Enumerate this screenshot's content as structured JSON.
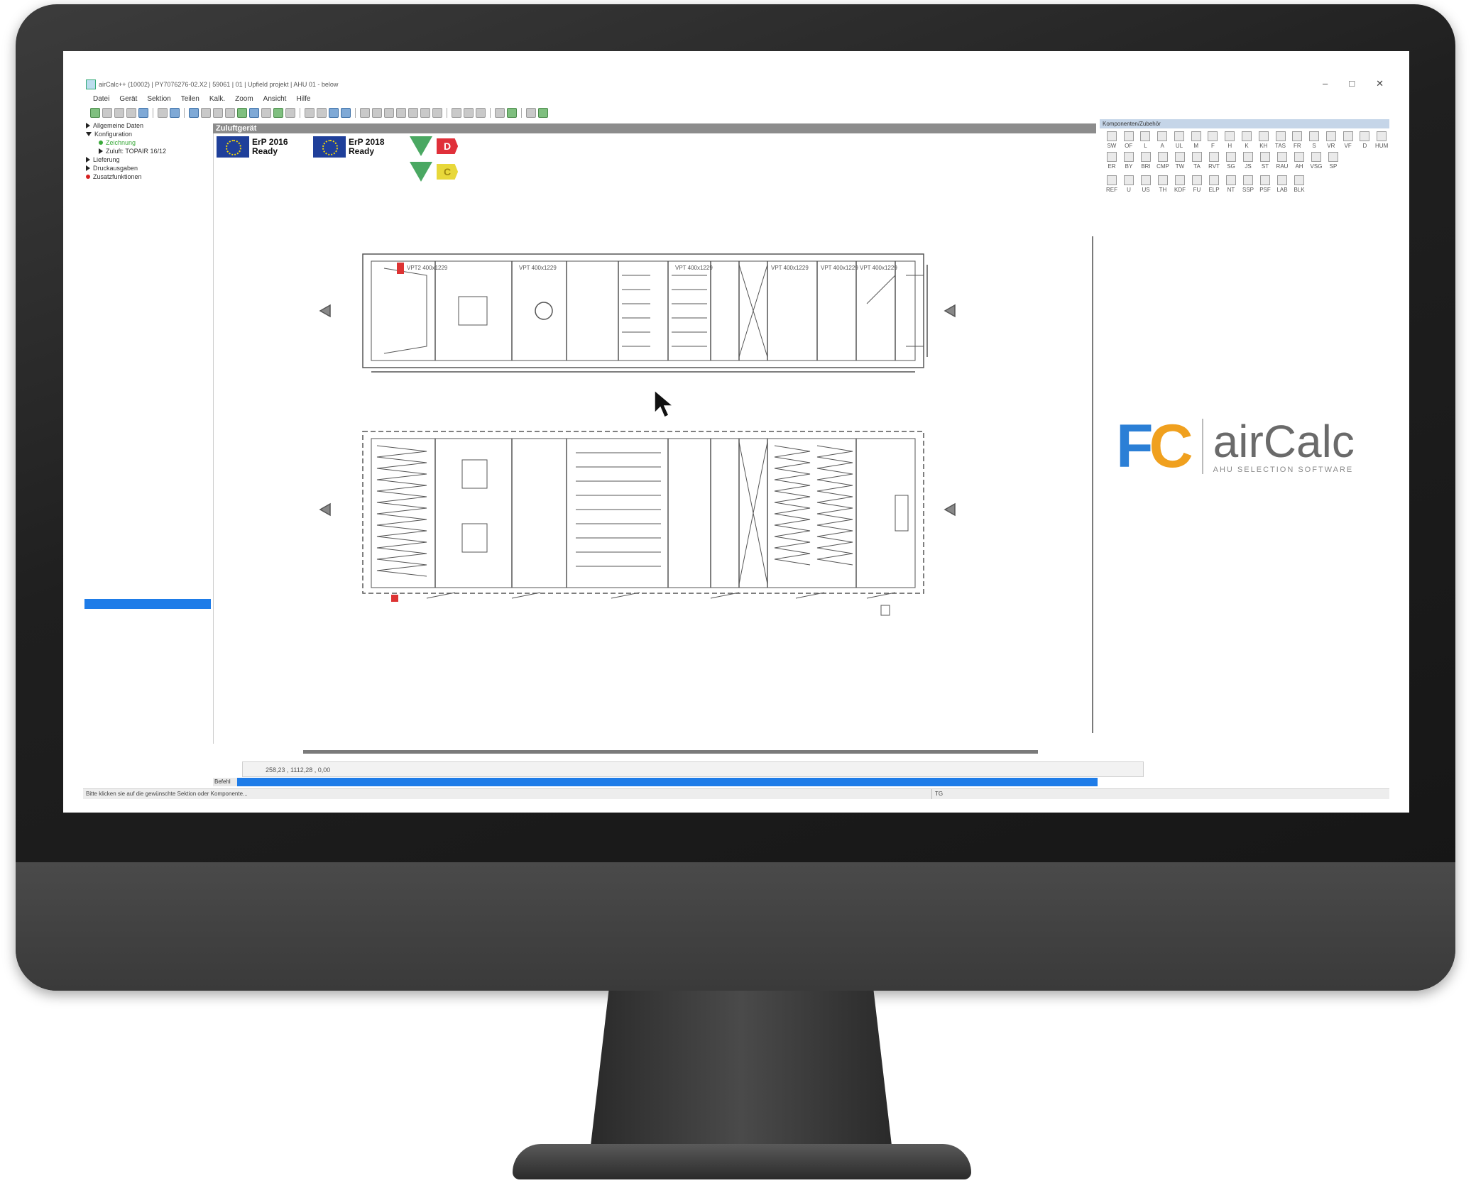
{
  "window": {
    "title": "airCalc++ (10002) | PY7076276-02.X2 | 59061 | 01 | Upfield projekt | AHU 01 - below",
    "controls": [
      "–",
      "□",
      "✕"
    ]
  },
  "menu": {
    "items": [
      "Datei",
      "Gerät",
      "Sektion",
      "Teilen",
      "Kalk.",
      "Zoom",
      "Ansicht",
      "Hilfe"
    ]
  },
  "tree": {
    "items": [
      {
        "label": "Allgemeine Daten"
      },
      {
        "label": "Konfiguration"
      },
      {
        "label": "Zeichnung"
      },
      {
        "label": "Zuluft: TOPAIR 16/12"
      },
      {
        "label": "Lieferung"
      },
      {
        "label": "Druckausgaben"
      },
      {
        "label": "Zusatzfunktionen"
      }
    ]
  },
  "drawing": {
    "header": "Zuluftgerät",
    "erp": [
      {
        "year": "ErP 2016",
        "status": "Ready"
      },
      {
        "year": "ErP 2018",
        "status": "Ready"
      }
    ],
    "energy_classes": [
      {
        "grade": "D",
        "color": "#e0303a"
      },
      {
        "grade": "C",
        "color": "#e8d83a"
      }
    ],
    "fan_labels": [
      "VPT2 400x1229",
      "VPT 400x1229",
      "VPT 400x1229",
      "VPT 400x1229",
      "VPT 400x1229",
      "VPT 400x1229"
    ]
  },
  "coordinates": "258,23 , 1112,28 , 0,00",
  "command_label": "Befehl",
  "status": {
    "hint": "Bitte klicken sie auf die gewünschte Sektion oder Komponente...",
    "field": "TG"
  },
  "right_panel": {
    "header": "Komponenten/Zubehör",
    "row1": [
      "SW",
      "OF",
      "L",
      "A",
      "UL",
      "M",
      "F",
      "H",
      "K",
      "KH",
      "TAS",
      "FR",
      "S",
      "VR",
      "VF",
      "D",
      "HUM"
    ],
    "row2": [
      "ER",
      "BY",
      "BRI",
      "CMP",
      "TW",
      "TA",
      "RVT",
      "SG",
      "JS",
      "ST",
      "RAU",
      "AH",
      "VSG",
      "SP"
    ],
    "row3": [
      "REF",
      "U",
      "US",
      "TH",
      "KDF",
      "FU",
      "ELP",
      "NT",
      "SSP",
      "PSF",
      "LAB",
      "BLK"
    ]
  },
  "logo": {
    "letters_f": "F",
    "letters_c": "C",
    "name": "airCalc",
    "tagline": "AHU SELECTION SOFTWARE"
  },
  "colors": {
    "accent_blue": "#1e7ce8",
    "logo_blue": "#2b7fd6",
    "logo_orange": "#f0a01e"
  }
}
